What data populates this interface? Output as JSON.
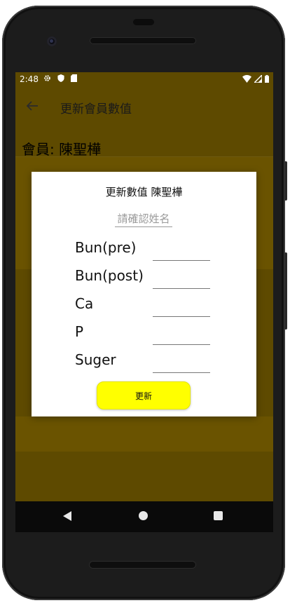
{
  "status": {
    "time": "2:48",
    "left_icons": [
      "settings-icon",
      "shield-icon",
      "sd-card-icon"
    ],
    "right_icons": [
      "wifi-icon",
      "signal-icon",
      "battery-icon"
    ]
  },
  "appbar": {
    "title": "更新會員數值",
    "background": "#5e4a00"
  },
  "member": {
    "label": "會員: 陳聖樺"
  },
  "dialog": {
    "title": "更新數值 陳聖樺",
    "confirm_name_placeholder": "請確認姓名",
    "confirm_name_value": "",
    "fields": [
      {
        "label": "Bun(pre)",
        "value": ""
      },
      {
        "label": "Bun(post)",
        "value": ""
      },
      {
        "label": "Ca",
        "value": ""
      },
      {
        "label": "P",
        "value": ""
      },
      {
        "label": "Suger",
        "value": ""
      }
    ],
    "update_label": "更新",
    "update_color": "#ffff00"
  },
  "navbar": {
    "items": [
      "back-triangle-icon",
      "home-circle-icon",
      "recents-square-icon"
    ]
  }
}
